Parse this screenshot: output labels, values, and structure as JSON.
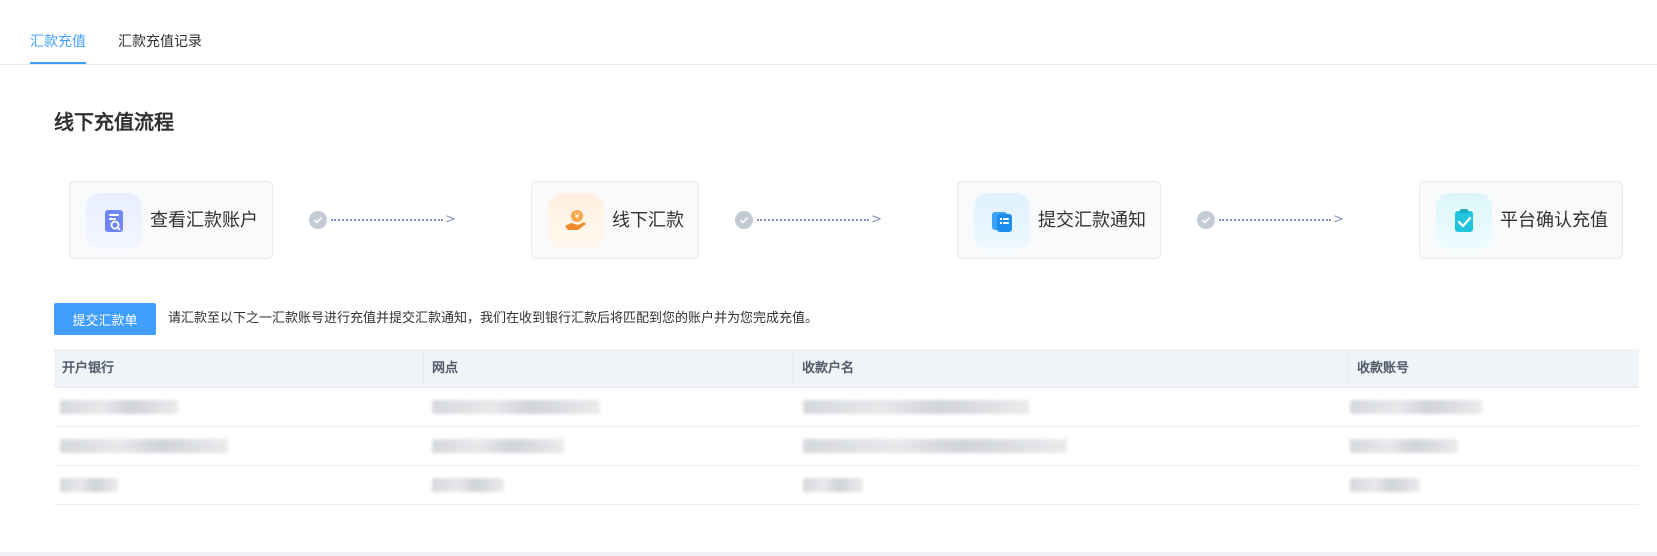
{
  "tabs": [
    {
      "label": "汇款充值",
      "active": true
    },
    {
      "label": "汇款充值记录",
      "active": false
    }
  ],
  "section_title": "线下充值流程",
  "steps": [
    {
      "label": "查看汇款账户",
      "icon": "search-document-icon"
    },
    {
      "label": "线下汇款",
      "icon": "hand-coin-icon"
    },
    {
      "label": "提交汇款通知",
      "icon": "clipboard-list-icon"
    },
    {
      "label": "平台确认充值",
      "icon": "clipboard-check-icon"
    }
  ],
  "connector_arrow": ">",
  "submit_button": "提交汇款单",
  "notice": "请汇款至以下之一汇款账号进行充值并提交汇款通知，我们在收到银行汇款后将匹配到您的账户并为您完成充值。",
  "table": {
    "columns": [
      "开户银行",
      "网点",
      "收款户名",
      "收款账号"
    ]
  },
  "colors": {
    "accent": "#409eff",
    "step_bg": "#f9fafc",
    "table_header_bg": "#f0f4f9"
  }
}
